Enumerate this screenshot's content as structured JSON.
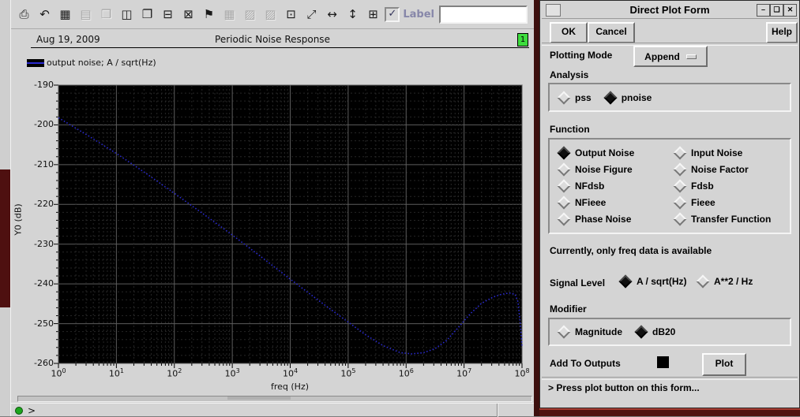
{
  "toolbar": {
    "label_checkbox_label": "Label",
    "label_checkbox_checked": "✓",
    "label_field_value": "",
    "icons": [
      {
        "name": "print-icon",
        "glyph": "⎙",
        "enabled": true
      },
      {
        "name": "undo-icon",
        "glyph": "↶",
        "enabled": true
      },
      {
        "name": "grid-toggle-icon",
        "glyph": "▦",
        "enabled": true
      },
      {
        "name": "strip-mode-icon",
        "glyph": "▤",
        "enabled": false
      },
      {
        "name": "overlay-window-icon",
        "glyph": "❒",
        "enabled": false
      },
      {
        "name": "subwindow-switch-icon",
        "glyph": "◫",
        "enabled": true
      },
      {
        "name": "new-subwindow-icon",
        "glyph": "❐",
        "enabled": true
      },
      {
        "name": "delete-subwindow-icon",
        "glyph": "⊟",
        "enabled": true
      },
      {
        "name": "subwindow-resize-icon",
        "glyph": "⊠",
        "enabled": true
      },
      {
        "name": "annotation-label-icon",
        "glyph": "⚑",
        "enabled": true
      },
      {
        "name": "data-table-icon",
        "glyph": "▦",
        "enabled": false
      },
      {
        "name": "waveform-cut-icon",
        "glyph": "▨",
        "enabled": false
      },
      {
        "name": "waveform-paste-icon",
        "glyph": "▨",
        "enabled": false
      },
      {
        "name": "calculator-icon",
        "glyph": "⊡",
        "enabled": true
      },
      {
        "name": "zoom-fit-icon",
        "glyph": "⤢",
        "enabled": true
      },
      {
        "name": "zoom-x-icon",
        "glyph": "↔",
        "enabled": true
      },
      {
        "name": "zoom-y-icon",
        "glyph": "↕",
        "enabled": true
      },
      {
        "name": "fit-window-icon",
        "glyph": "⊞",
        "enabled": true
      }
    ]
  },
  "header": {
    "date": "Aug 19, 2009",
    "title": "Periodic Noise Response",
    "window_badge": "1"
  },
  "legend": {
    "text": "output noise; A / sqrt(Hz)"
  },
  "chart_data": {
    "type": "line",
    "title": "Periodic Noise Response",
    "xlabel": "freq (Hz)",
    "ylabel": "Y0 (dB)",
    "x_scale": "log",
    "xlim_log10": [
      0,
      8
    ],
    "ylim": [
      -260,
      -190
    ],
    "x_tick_exponents": [
      0,
      1,
      2,
      3,
      4,
      5,
      6,
      7,
      8
    ],
    "y_ticks": [
      -190,
      -200,
      -210,
      -220,
      -230,
      -240,
      -250,
      -260
    ],
    "grid": "on",
    "plot_bg": "#000000",
    "legend_position": "top-left",
    "series": [
      {
        "name": "output noise; A / sqrt(Hz)",
        "color": "#2a2ad0",
        "style": "dotted",
        "points": [
          [
            0.0,
            -198.2
          ],
          [
            0.25,
            -200.4
          ],
          [
            0.5,
            -202.6
          ],
          [
            0.75,
            -204.9
          ],
          [
            1.0,
            -207.2
          ],
          [
            1.5,
            -212.1
          ],
          [
            2.0,
            -217.2
          ],
          [
            2.5,
            -222.4
          ],
          [
            3.0,
            -227.7
          ],
          [
            3.5,
            -233.2
          ],
          [
            4.0,
            -238.8
          ],
          [
            4.5,
            -244.3
          ],
          [
            5.0,
            -249.6
          ],
          [
            5.3,
            -252.8
          ],
          [
            5.6,
            -255.5
          ],
          [
            5.9,
            -257.3
          ],
          [
            6.1,
            -257.6
          ],
          [
            6.3,
            -257.3
          ],
          [
            6.5,
            -256.3
          ],
          [
            6.7,
            -254.2
          ],
          [
            6.9,
            -251.0
          ],
          [
            7.1,
            -247.6
          ],
          [
            7.3,
            -244.9
          ],
          [
            7.5,
            -243.3
          ],
          [
            7.65,
            -242.6
          ],
          [
            7.78,
            -242.3
          ],
          [
            7.88,
            -242.6
          ],
          [
            7.93,
            -244.5
          ],
          [
            7.97,
            -250.0
          ],
          [
            8.0,
            -255.5
          ]
        ]
      }
    ]
  },
  "statusbar": {
    "prompt": ">"
  },
  "dialog": {
    "title": "Direct Plot Form",
    "window_buttons": {
      "minimize": "–",
      "maximize": "❑",
      "close": "✕"
    },
    "ok_label": "OK",
    "cancel_label": "Cancel",
    "help_label": "Help",
    "plotting_mode": {
      "label": "Plotting Mode",
      "value": "Append"
    },
    "analysis": {
      "label": "Analysis",
      "options": [
        {
          "label": "pss",
          "selected": false
        },
        {
          "label": "pnoise",
          "selected": true
        }
      ]
    },
    "function": {
      "label": "Function",
      "options": [
        {
          "label": "Output Noise",
          "selected": true
        },
        {
          "label": "Input Noise",
          "selected": false
        },
        {
          "label": "Noise Figure",
          "selected": false
        },
        {
          "label": "Noise Factor",
          "selected": false
        },
        {
          "label": "NFdsb",
          "selected": false
        },
        {
          "label": "Fdsb",
          "selected": false
        },
        {
          "label": "NFieee",
          "selected": false
        },
        {
          "label": "Fieee",
          "selected": false
        },
        {
          "label": "Phase Noise",
          "selected": false
        },
        {
          "label": "Transfer Function",
          "selected": false
        }
      ]
    },
    "notice": "Currently, only freq data is available",
    "signal_level": {
      "label": "Signal Level",
      "options": [
        {
          "label": "A / sqrt(Hz)",
          "selected": true
        },
        {
          "label": "A**2 / Hz",
          "selected": false
        }
      ]
    },
    "modifier": {
      "label": "Modifier",
      "options": [
        {
          "label": "Magnitude",
          "selected": false
        },
        {
          "label": "dB20",
          "selected": true
        }
      ]
    },
    "add_to_outputs": {
      "label": "Add To Outputs",
      "checked": true
    },
    "plot_label": "Plot",
    "status": "> Press plot button on this form..."
  }
}
